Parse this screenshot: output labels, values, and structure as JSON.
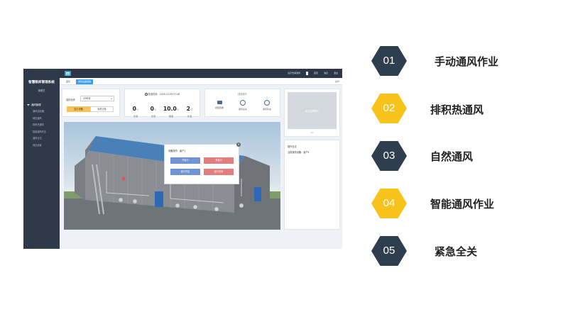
{
  "app": {
    "title": "智慧粮库管理系统",
    "user": "管理员",
    "nav_group": "通风管理",
    "nav_items": [
      "通风控制器",
      "阀控通风",
      "排积热通风",
      "智能通风作业",
      "通风日志",
      "阀控设置"
    ],
    "topbar_items": [
      "演示仓库通风",
      "首页",
      "消息",
      "退出"
    ],
    "tabs": [
      "首页",
      "通风设备控制"
    ],
    "tab_right": "操作"
  },
  "controls": {
    "warehouse_label": "选择仓房",
    "warehouse_value": "25号仓",
    "btn_primary": "显示设备",
    "btn_secondary": "隐藏设备"
  },
  "metrics": {
    "time": "检测时间：2018-12-09 07:46",
    "items": [
      {
        "value": "0",
        "unit": "℃",
        "label": "仓温"
      },
      {
        "value": "0",
        "unit": "℃",
        "label": "仓湿"
      },
      {
        "value": "10.0",
        "unit": "℃",
        "label": "粮温"
      },
      {
        "value": "2",
        "unit": "℃",
        "label": "外温"
      }
    ]
  },
  "quick": {
    "title": "快捷操作",
    "items": [
      {
        "label": "视频查看",
        "icon": "camera-icon"
      },
      {
        "label": "通风全关",
        "icon": "fan-icon"
      },
      {
        "label": "通风状态",
        "icon": "status-icon"
      }
    ]
  },
  "image_panel": {
    "placeholder": "暂无通风照片",
    "pager": "1/1"
  },
  "info_panel": {
    "title": "操作日志",
    "line": "当前操作设备：窗户1"
  },
  "modal": {
    "title": "设备操作：窗户1",
    "buttons": [
      {
        "label": "开窗口",
        "color": "blue"
      },
      {
        "label": "关窗口",
        "color": "red"
      },
      {
        "label": "窗口开启",
        "color": "blue"
      },
      {
        "label": "窗口关闭",
        "color": "red"
      }
    ]
  },
  "options": [
    {
      "num": "01",
      "label": "手动通风作业",
      "style": "dark"
    },
    {
      "num": "02",
      "label": "排积热通风",
      "style": "gold"
    },
    {
      "num": "03",
      "label": "自然通风",
      "style": "dark"
    },
    {
      "num": "04",
      "label": "智能通风作业",
      "style": "gold"
    },
    {
      "num": "05",
      "label": "紧急全关",
      "style": "dark"
    }
  ],
  "colors": {
    "dark_hex": "#2f3e4f",
    "gold_hex": "#f7c31a",
    "accent_blue": "#3a9ff0"
  }
}
